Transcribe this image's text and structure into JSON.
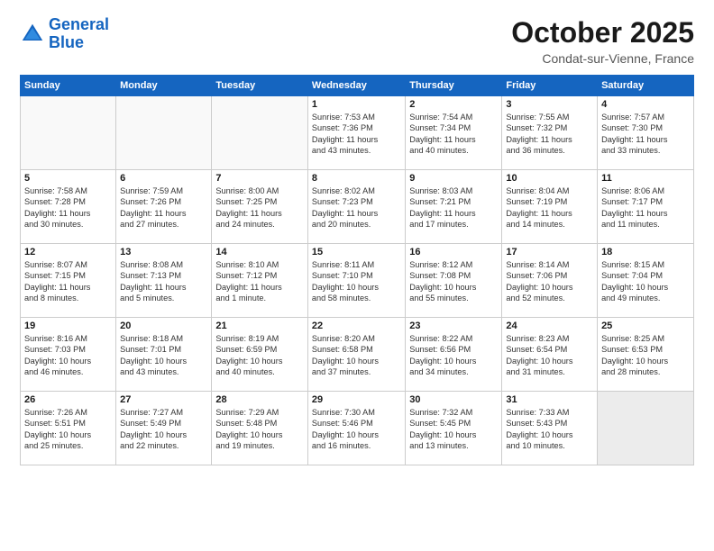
{
  "header": {
    "logo_line1": "General",
    "logo_line2": "Blue",
    "month": "October 2025",
    "location": "Condat-sur-Vienne, France"
  },
  "weekdays": [
    "Sunday",
    "Monday",
    "Tuesday",
    "Wednesday",
    "Thursday",
    "Friday",
    "Saturday"
  ],
  "weeks": [
    [
      {
        "day": "",
        "info": ""
      },
      {
        "day": "",
        "info": ""
      },
      {
        "day": "",
        "info": ""
      },
      {
        "day": "1",
        "info": "Sunrise: 7:53 AM\nSunset: 7:36 PM\nDaylight: 11 hours\nand 43 minutes."
      },
      {
        "day": "2",
        "info": "Sunrise: 7:54 AM\nSunset: 7:34 PM\nDaylight: 11 hours\nand 40 minutes."
      },
      {
        "day": "3",
        "info": "Sunrise: 7:55 AM\nSunset: 7:32 PM\nDaylight: 11 hours\nand 36 minutes."
      },
      {
        "day": "4",
        "info": "Sunrise: 7:57 AM\nSunset: 7:30 PM\nDaylight: 11 hours\nand 33 minutes."
      }
    ],
    [
      {
        "day": "5",
        "info": "Sunrise: 7:58 AM\nSunset: 7:28 PM\nDaylight: 11 hours\nand 30 minutes."
      },
      {
        "day": "6",
        "info": "Sunrise: 7:59 AM\nSunset: 7:26 PM\nDaylight: 11 hours\nand 27 minutes."
      },
      {
        "day": "7",
        "info": "Sunrise: 8:00 AM\nSunset: 7:25 PM\nDaylight: 11 hours\nand 24 minutes."
      },
      {
        "day": "8",
        "info": "Sunrise: 8:02 AM\nSunset: 7:23 PM\nDaylight: 11 hours\nand 20 minutes."
      },
      {
        "day": "9",
        "info": "Sunrise: 8:03 AM\nSunset: 7:21 PM\nDaylight: 11 hours\nand 17 minutes."
      },
      {
        "day": "10",
        "info": "Sunrise: 8:04 AM\nSunset: 7:19 PM\nDaylight: 11 hours\nand 14 minutes."
      },
      {
        "day": "11",
        "info": "Sunrise: 8:06 AM\nSunset: 7:17 PM\nDaylight: 11 hours\nand 11 minutes."
      }
    ],
    [
      {
        "day": "12",
        "info": "Sunrise: 8:07 AM\nSunset: 7:15 PM\nDaylight: 11 hours\nand 8 minutes."
      },
      {
        "day": "13",
        "info": "Sunrise: 8:08 AM\nSunset: 7:13 PM\nDaylight: 11 hours\nand 5 minutes."
      },
      {
        "day": "14",
        "info": "Sunrise: 8:10 AM\nSunset: 7:12 PM\nDaylight: 11 hours\nand 1 minute."
      },
      {
        "day": "15",
        "info": "Sunrise: 8:11 AM\nSunset: 7:10 PM\nDaylight: 10 hours\nand 58 minutes."
      },
      {
        "day": "16",
        "info": "Sunrise: 8:12 AM\nSunset: 7:08 PM\nDaylight: 10 hours\nand 55 minutes."
      },
      {
        "day": "17",
        "info": "Sunrise: 8:14 AM\nSunset: 7:06 PM\nDaylight: 10 hours\nand 52 minutes."
      },
      {
        "day": "18",
        "info": "Sunrise: 8:15 AM\nSunset: 7:04 PM\nDaylight: 10 hours\nand 49 minutes."
      }
    ],
    [
      {
        "day": "19",
        "info": "Sunrise: 8:16 AM\nSunset: 7:03 PM\nDaylight: 10 hours\nand 46 minutes."
      },
      {
        "day": "20",
        "info": "Sunrise: 8:18 AM\nSunset: 7:01 PM\nDaylight: 10 hours\nand 43 minutes."
      },
      {
        "day": "21",
        "info": "Sunrise: 8:19 AM\nSunset: 6:59 PM\nDaylight: 10 hours\nand 40 minutes."
      },
      {
        "day": "22",
        "info": "Sunrise: 8:20 AM\nSunset: 6:58 PM\nDaylight: 10 hours\nand 37 minutes."
      },
      {
        "day": "23",
        "info": "Sunrise: 8:22 AM\nSunset: 6:56 PM\nDaylight: 10 hours\nand 34 minutes."
      },
      {
        "day": "24",
        "info": "Sunrise: 8:23 AM\nSunset: 6:54 PM\nDaylight: 10 hours\nand 31 minutes."
      },
      {
        "day": "25",
        "info": "Sunrise: 8:25 AM\nSunset: 6:53 PM\nDaylight: 10 hours\nand 28 minutes."
      }
    ],
    [
      {
        "day": "26",
        "info": "Sunrise: 7:26 AM\nSunset: 5:51 PM\nDaylight: 10 hours\nand 25 minutes."
      },
      {
        "day": "27",
        "info": "Sunrise: 7:27 AM\nSunset: 5:49 PM\nDaylight: 10 hours\nand 22 minutes."
      },
      {
        "day": "28",
        "info": "Sunrise: 7:29 AM\nSunset: 5:48 PM\nDaylight: 10 hours\nand 19 minutes."
      },
      {
        "day": "29",
        "info": "Sunrise: 7:30 AM\nSunset: 5:46 PM\nDaylight: 10 hours\nand 16 minutes."
      },
      {
        "day": "30",
        "info": "Sunrise: 7:32 AM\nSunset: 5:45 PM\nDaylight: 10 hours\nand 13 minutes."
      },
      {
        "day": "31",
        "info": "Sunrise: 7:33 AM\nSunset: 5:43 PM\nDaylight: 10 hours\nand 10 minutes."
      },
      {
        "day": "",
        "info": ""
      }
    ]
  ]
}
